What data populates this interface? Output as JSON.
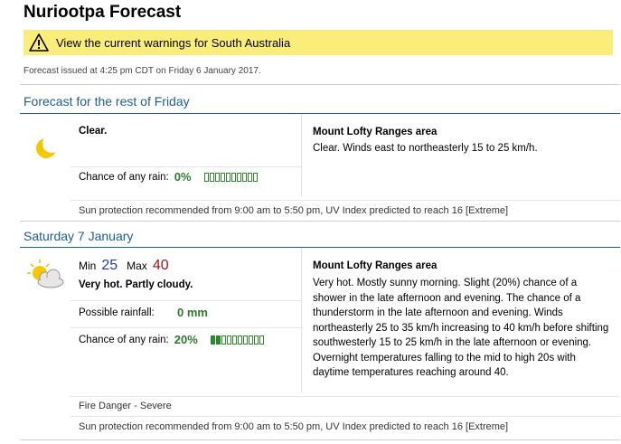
{
  "page": {
    "title": "Nuriootpa Forecast"
  },
  "warning": {
    "text": "View the current warnings for South Australia",
    "icon": "warning-triangle-icon",
    "background": "#fbed7a"
  },
  "issued": "Forecast issued at 4:25 pm CDT on Friday 6 January 2017.",
  "today": {
    "heading": "Forecast for the rest of Friday",
    "icon": "moon-icon",
    "summary": "Clear.",
    "rain_label": "Chance of any rain:",
    "rain_value": "0%",
    "rain_fraction": 0,
    "area_title": "Mount Lofty Ranges area",
    "area_text": "Clear. Winds east to northeasterly 15 to 25 km/h.",
    "sun_note": "Sun protection recommended from 9:00 am to 5:50 pm, UV Index predicted to reach 16 [Extreme]"
  },
  "saturday": {
    "heading": "Saturday 7 January",
    "icon": "sun-partly-cloudy-icon",
    "min_label": "Min",
    "min_value": "25",
    "max_label": "Max",
    "max_value": "40",
    "summary": "Very hot. Partly cloudy.",
    "rainfall_label": "Possible rainfall:",
    "rainfall_value": "0 mm",
    "rain_label": "Chance of any rain:",
    "rain_value": "20%",
    "rain_fraction": 0.2,
    "area_title": "Mount Lofty Ranges area",
    "area_text": "Very hot. Mostly sunny morning. Slight (20%) chance of a shower in the late afternoon and evening. The chance of a thunderstorm in the late afternoon and evening. Winds northeasterly 25 to 35 km/h increasing to 40 km/h before shifting southwesterly 15 to 25 km/h in the late afternoon or evening. Overnight temperatures falling to the mid to high 20s with daytime temperatures reaching around 40.",
    "fire_danger": "Fire Danger - Severe",
    "sun_note": "Sun protection recommended from 9:00 am to 5:50 pm, UV Index predicted to reach 16 [Extreme]"
  }
}
